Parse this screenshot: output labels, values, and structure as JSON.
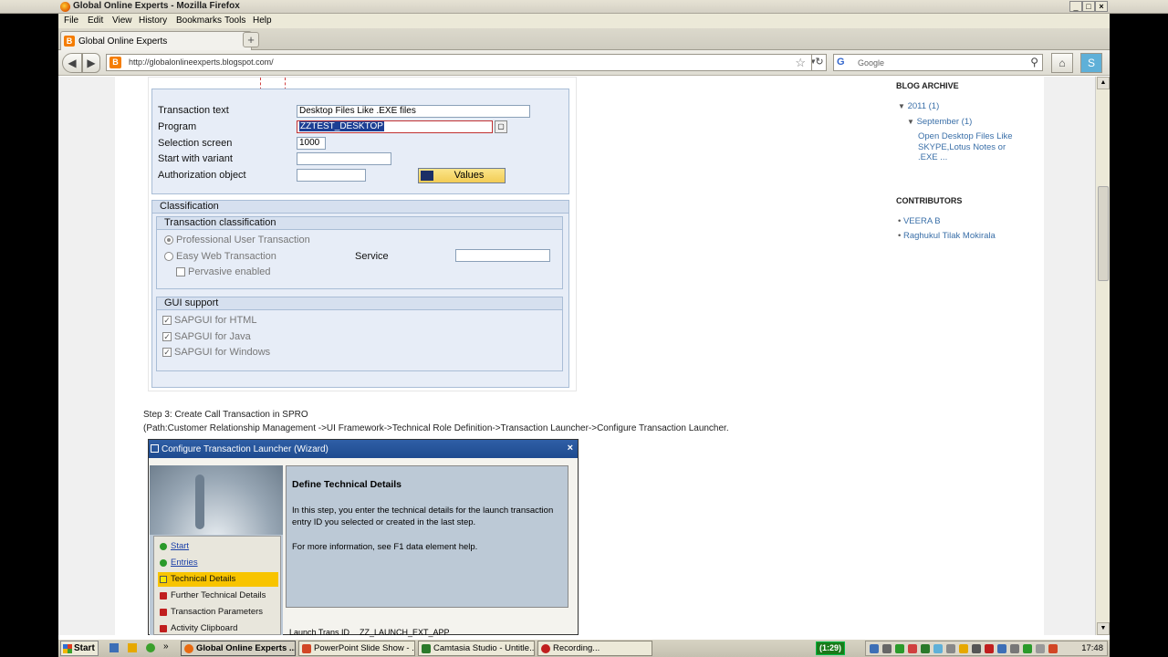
{
  "window": {
    "title": "Global Online Experts - Mozilla Firefox",
    "controls": {
      "minimize": "_",
      "maximize": "□",
      "close": "×"
    }
  },
  "menu": [
    "File",
    "Edit",
    "View",
    "History",
    "Bookmarks",
    "Tools",
    "Help"
  ],
  "tab": {
    "title": "Global Online Experts",
    "new_tab": "+"
  },
  "nav": {
    "url": "http://globalonlineexperts.blogspot.com/",
    "search_placeholder": "Google"
  },
  "sap1": {
    "fields": [
      {
        "label": "Transaction text",
        "value": "Desktop Files Like .EXE files"
      },
      {
        "label": "Program",
        "value": "ZZTEST_DESKTOP"
      },
      {
        "label": "Selection screen",
        "value": "1000"
      },
      {
        "label": "Start with variant",
        "value": ""
      },
      {
        "label": "Authorization object",
        "value": ""
      }
    ],
    "values_button": "Values",
    "classification_title": "Classification",
    "transaction_classification_title": "Transaction classification",
    "radio_professional": "Professional User Transaction",
    "radio_easyweb": "Easy Web Transaction",
    "service_label": "Service",
    "pervasive": "Pervasive enabled",
    "gui_support_title": "GUI support",
    "gui_html": "SAPGUI for HTML",
    "gui_java": "SAPGUI for Java",
    "gui_windows": "SAPGUI for Windows"
  },
  "post": {
    "step3": "Step 3: Create Call Transaction in SPRO",
    "path": "(Path:Customer Relationship Management ->UI Framework->Technical Role Definition->Transaction Launcher->Configure Transaction Launcher."
  },
  "wizard": {
    "title": "Configure Transaction Launcher (Wizard)",
    "close": "×",
    "steps": [
      {
        "label": "Start",
        "state": "done"
      },
      {
        "label": "Entries",
        "state": "done"
      },
      {
        "label": "Technical Details",
        "state": "current"
      },
      {
        "label": "Further Technical Details",
        "state": "todo"
      },
      {
        "label": "Transaction Parameters",
        "state": "todo"
      },
      {
        "label": "Activity Clipboard Integration",
        "state": "todo"
      }
    ],
    "heading": "Define Technical Details",
    "para1": "In this step, you enter the technical details for the launch transaction entry ID you selected or created in the last step.",
    "para2": "For more information, see F1 data element help.",
    "launch_label": "Launch Trans ID",
    "launch_value": "ZZ_LAUNCH_EXT_APP"
  },
  "sidebar": {
    "archive_title": "BLOG ARCHIVE",
    "year": "2011 (1)",
    "month": "September (1)",
    "post_title": "Open Desktop Files Like SKYPE,Lotus Notes or .EXE ...",
    "contributors_title": "CONTRIBUTORS",
    "contributors": [
      "VEERA B",
      "Raghukul Tilak Mokirala"
    ]
  },
  "taskbar": {
    "start": "Start",
    "tasks": [
      {
        "label": "Global Online Experts ...",
        "active": true
      },
      {
        "label": "PowerPoint Slide Show - ...",
        "active": false
      },
      {
        "label": "Camtasia Studio - Untitle...",
        "active": false
      },
      {
        "label": "Recording...",
        "active": false
      }
    ],
    "recorder": "(1:29)",
    "clock": "17:48"
  }
}
